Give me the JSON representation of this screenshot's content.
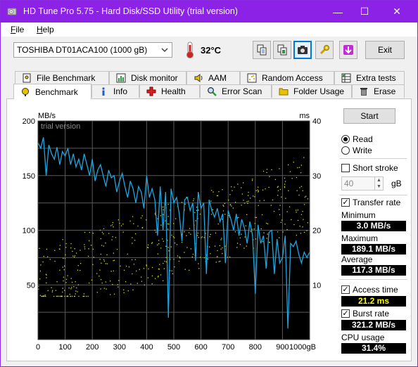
{
  "window": {
    "title": "HD Tune Pro 5.75 - Hard Disk/SSD Utility (trial version)",
    "minimize_glyph": "—",
    "maximize_glyph": "☐",
    "close_glyph": "✕"
  },
  "menu": [
    {
      "label": "File",
      "mnemonic": "F"
    },
    {
      "label": "Help",
      "mnemonic": "H"
    }
  ],
  "toolbar": {
    "drive": "TOSHIBA DT01ACA100 (1000 gB)",
    "temperature": "32°C",
    "exit_label": "Exit"
  },
  "tabs_row1": [
    "File Benchmark",
    "Disk monitor",
    "AAM",
    "Random Access",
    "Extra tests"
  ],
  "tabs_row2": [
    "Benchmark",
    "Info",
    "Health",
    "Error Scan",
    "Folder Usage",
    "Erase"
  ],
  "selected_tab": "Benchmark",
  "controls": {
    "start_label": "Start",
    "read_label": "Read",
    "write_label": "Write",
    "mode": "read",
    "short_stroke_label": "Short stroke",
    "short_stroke_checked": false,
    "short_stroke_value": "40",
    "short_stroke_unit": "gB",
    "transfer_rate_label": "Transfer rate",
    "transfer_rate_checked": true,
    "minimum_label": "Minimum",
    "minimum_value": "3.0 MB/s",
    "maximum_label": "Maximum",
    "maximum_value": "189.1 MB/s",
    "average_label": "Average",
    "average_value": "117.3 MB/s",
    "access_time_label": "Access time",
    "access_time_checked": true,
    "access_time_value": "21.2 ms",
    "burst_rate_label": "Burst rate",
    "burst_rate_checked": true,
    "burst_rate_value": "321.2 MB/s",
    "cpu_usage_label": "CPU usage",
    "cpu_usage_value": "31.4%"
  },
  "colors": {
    "titlebar": "#8b22e6",
    "chart_bg": "#000000",
    "transfer_line": "#1fa6e0",
    "access_dots": "#d8d820",
    "grid": "#5a5a5a"
  },
  "chart_data": {
    "type": "line",
    "watermark": "trial version",
    "left_unit": "MB/s",
    "right_unit": "ms",
    "x_ticks": [
      "0",
      "100",
      "200",
      "300",
      "400",
      "500",
      "600",
      "700",
      "800",
      "900",
      "1000gB"
    ],
    "y_left_ticks": [
      "200",
      "150",
      "100",
      "50"
    ],
    "y_right_ticks": [
      "40",
      "30",
      "20",
      "10"
    ],
    "xlim": [
      0,
      1000
    ],
    "ylim_left": [
      0,
      200
    ],
    "ylim_right": [
      0,
      40
    ],
    "grid": true,
    "series": [
      {
        "axis": "left",
        "x": [
          0,
          10,
          20,
          30,
          40,
          50,
          60,
          70,
          80,
          90,
          100,
          110,
          120,
          130,
          140,
          150,
          160,
          170,
          180,
          190,
          200,
          210,
          220,
          230,
          240,
          250,
          260,
          270,
          280,
          290,
          300,
          310,
          320,
          330,
          340,
          350,
          360,
          370,
          380,
          390,
          400,
          410,
          420,
          430,
          440,
          450,
          460,
          470,
          480,
          490,
          500,
          510,
          520,
          530,
          540,
          550,
          560,
          570,
          580,
          590,
          600,
          610,
          620,
          630,
          640,
          650,
          660,
          670,
          680,
          690,
          700,
          710,
          720,
          730,
          740,
          750,
          760,
          770,
          780,
          790,
          800,
          810,
          820,
          830,
          840,
          850,
          860,
          870,
          880,
          890,
          900,
          910,
          920,
          930,
          940,
          950,
          960,
          970,
          980,
          990,
          1000
        ],
        "values": [
          180,
          175,
          185,
          150,
          178,
          170,
          165,
          176,
          160,
          172,
          168,
          175,
          160,
          170,
          158,
          165,
          155,
          170,
          160,
          150,
          165,
          145,
          155,
          160,
          150,
          140,
          155,
          148,
          150,
          135,
          145,
          152,
          140,
          130,
          145,
          138,
          125,
          140,
          135,
          120,
          150,
          130,
          138,
          128,
          95,
          140,
          100,
          135,
          20,
          138,
          125,
          130,
          115,
          90,
          128,
          130,
          118,
          125,
          72,
          135,
          120,
          125,
          60,
          128,
          118,
          112,
          120,
          108,
          115,
          70,
          118,
          110,
          100,
          115,
          95,
          110,
          102,
          88,
          108,
          95,
          42,
          105,
          88,
          95,
          65,
          98,
          100,
          60,
          92,
          70,
          75,
          95,
          10,
          88,
          85,
          90,
          78,
          70,
          80,
          75,
          80
        ]
      },
      {
        "axis": "right",
        "type": "scatter",
        "x_range": [
          0,
          1000
        ],
        "y_range": [
          8,
          32
        ]
      }
    ]
  }
}
